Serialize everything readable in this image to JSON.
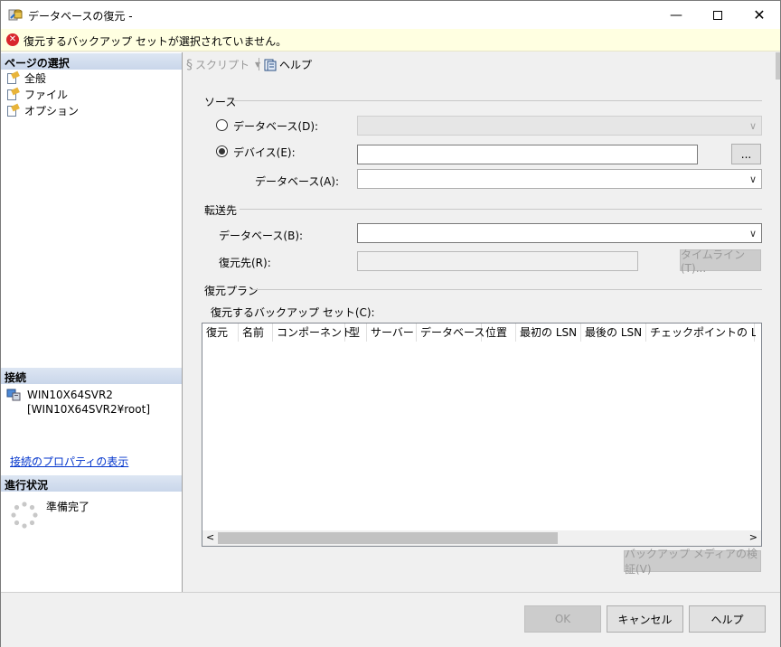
{
  "window": {
    "title": "データベースの復元 -"
  },
  "error": {
    "message": "復元するバックアップ セットが選択されていません。"
  },
  "left": {
    "page_select_header": "ページの選択",
    "pages": [
      "全般",
      "ファイル",
      "オプション"
    ],
    "connection_header": "接続",
    "server": "WIN10X64SVR2",
    "login": "[WIN10X64SVR2¥root]",
    "view_props_link": "接続のプロパティの表示",
    "progress_header": "進行状況",
    "progress_status": "準備完了"
  },
  "toolbar": {
    "script": "スクリプト",
    "help": "ヘルプ"
  },
  "source": {
    "group": "ソース",
    "database_radio": "データベース(D):",
    "device_radio": "デバイス(E):",
    "database_label": "データベース(A):",
    "browse": "..."
  },
  "dest": {
    "group": "転送先",
    "database_label": "データベース(B):",
    "restore_to_label": "復元先(R):",
    "timeline": "タイムライン(T)..."
  },
  "plan": {
    "group": "復元プラン",
    "sets_label": "復元するバックアップ セット(C):",
    "columns": [
      "復元",
      "名前",
      "コンポーネント",
      "型",
      "サーバー",
      "データベース",
      "位置",
      "最初の LSN",
      "最後の LSN",
      "チェックポイントの LSN"
    ],
    "verify": "バックアップ メディアの検証(V)"
  },
  "buttons": {
    "ok": "OK",
    "cancel": "キャンセル",
    "help": "ヘルプ"
  }
}
